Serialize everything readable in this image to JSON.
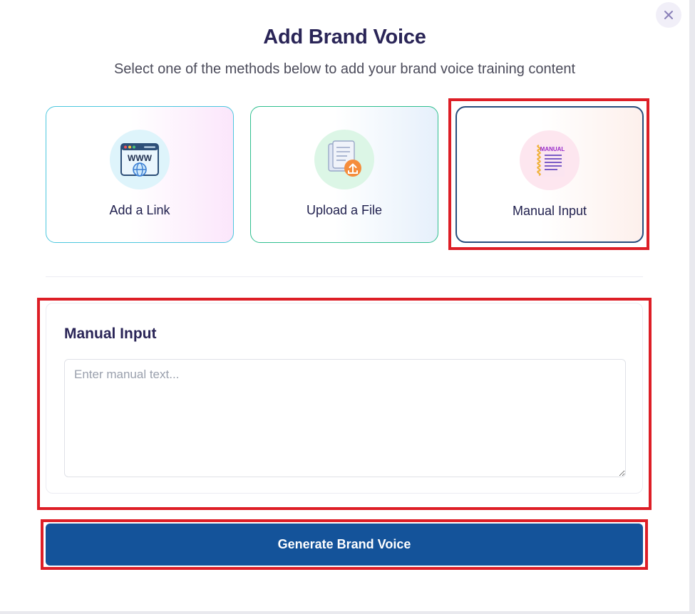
{
  "modal": {
    "title": "Add Brand Voice",
    "subtitle": "Select one of the methods below to add your brand voice training content",
    "close_icon": "close-icon"
  },
  "options": [
    {
      "label": "Add a Link",
      "icon": "www-globe-icon"
    },
    {
      "label": "Upload a File",
      "icon": "file-upload-icon"
    },
    {
      "label": "Manual Input",
      "icon": "manual-notebook-icon",
      "icon_text": "MANUAL",
      "selected": true
    }
  ],
  "manual_section": {
    "title": "Manual Input",
    "placeholder": "Enter manual text...",
    "value": ""
  },
  "actions": {
    "generate_label": "Generate Brand Voice"
  },
  "colors": {
    "title": "#2a2557",
    "primary_button": "#14539a",
    "highlight": "#dd1e26",
    "selected_border": "#274c7d"
  }
}
